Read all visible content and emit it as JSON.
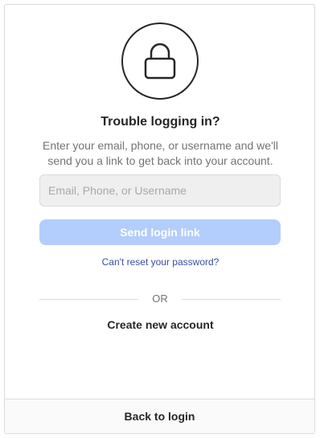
{
  "header": {
    "icon": "lock-icon",
    "title": "Trouble logging in?",
    "description": "Enter your email, phone, or username and we'll send you a link to get back into your account."
  },
  "form": {
    "identifier": {
      "value": "",
      "placeholder": "Email, Phone, or Username"
    },
    "send_label": "Send login link",
    "reset_link": "Can't reset your password?"
  },
  "divider": {
    "label": "OR"
  },
  "create_account_label": "Create new account",
  "footer": {
    "back_label": "Back to login"
  },
  "colors": {
    "primary_disabled": "#b3cdfc",
    "link": "#3a4fa0",
    "text": "#262626",
    "muted": "#737373",
    "border": "#dbdbdb"
  }
}
